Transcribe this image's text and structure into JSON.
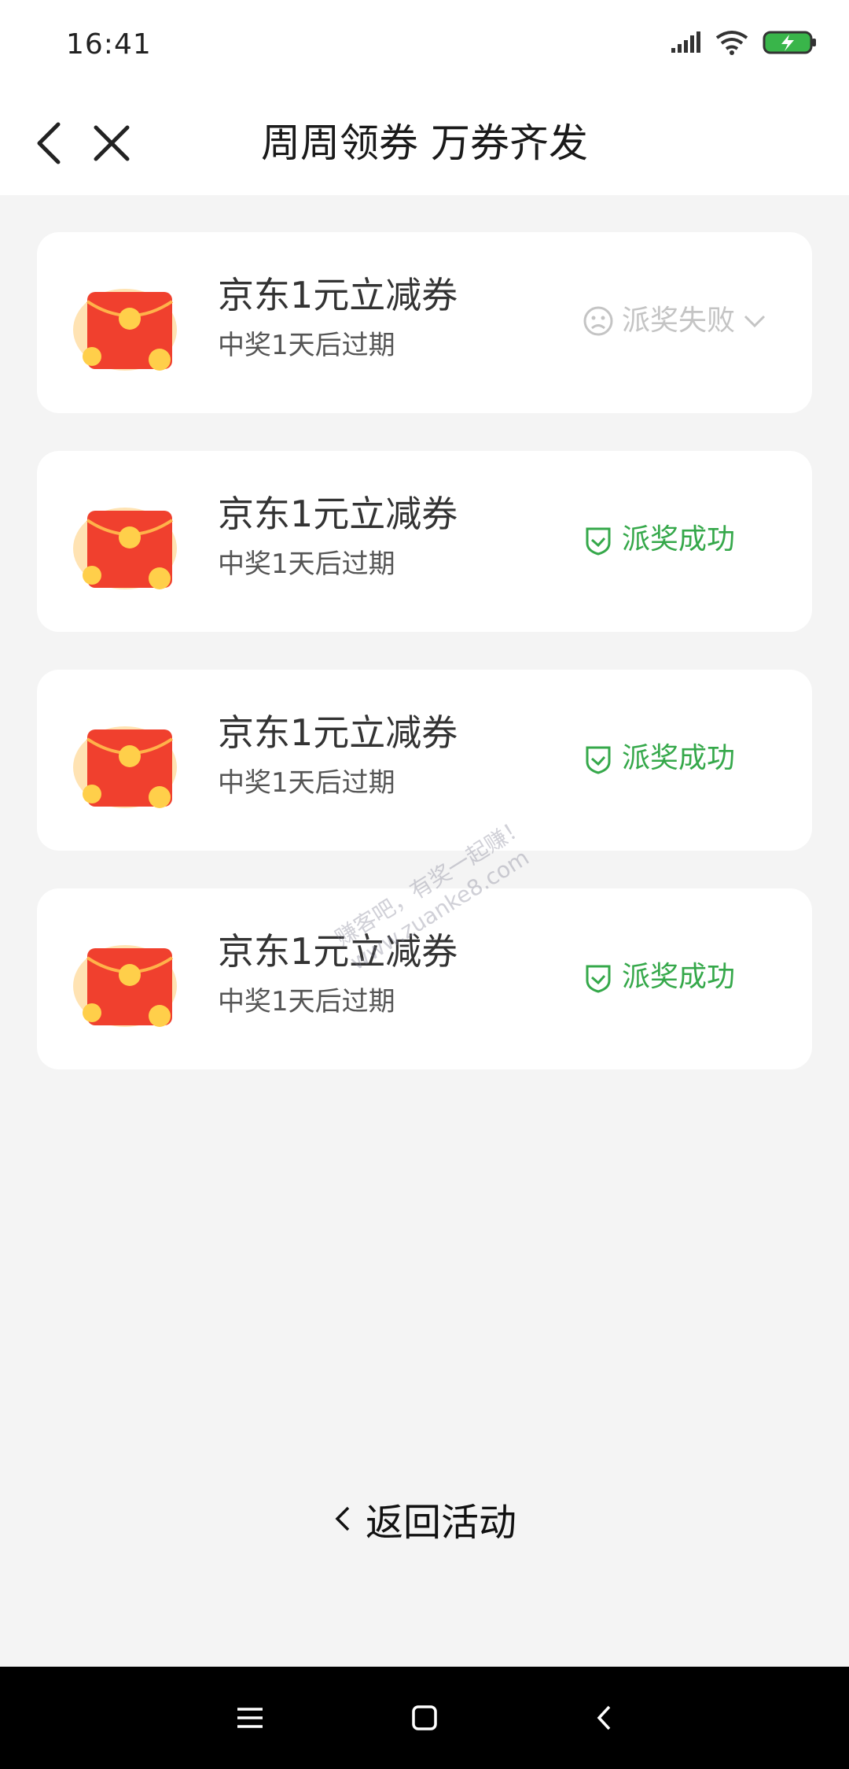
{
  "status_bar": {
    "time": "16:41"
  },
  "header": {
    "title": "周周领券 万券齐发"
  },
  "coupons": [
    {
      "title": "京东1元立减券",
      "subtitle": "中奖1天后过期",
      "status": "派奖失败",
      "status_type": "fail"
    },
    {
      "title": "京东1元立减券",
      "subtitle": "中奖1天后过期",
      "status": "派奖成功",
      "status_type": "success"
    },
    {
      "title": "京东1元立减券",
      "subtitle": "中奖1天后过期",
      "status": "派奖成功",
      "status_type": "success"
    },
    {
      "title": "京东1元立减券",
      "subtitle": "中奖1天后过期",
      "status": "派奖成功",
      "status_type": "success"
    }
  ],
  "watermark": {
    "line1": "赚客吧，有奖一起赚！",
    "line2": "www.zuanke8.com"
  },
  "footer": {
    "return_label": "返回活动"
  },
  "colors": {
    "success": "#35a84a",
    "fail": "#c4c4c4",
    "envelope": "#f0402e",
    "background": "#f4f4f4"
  }
}
